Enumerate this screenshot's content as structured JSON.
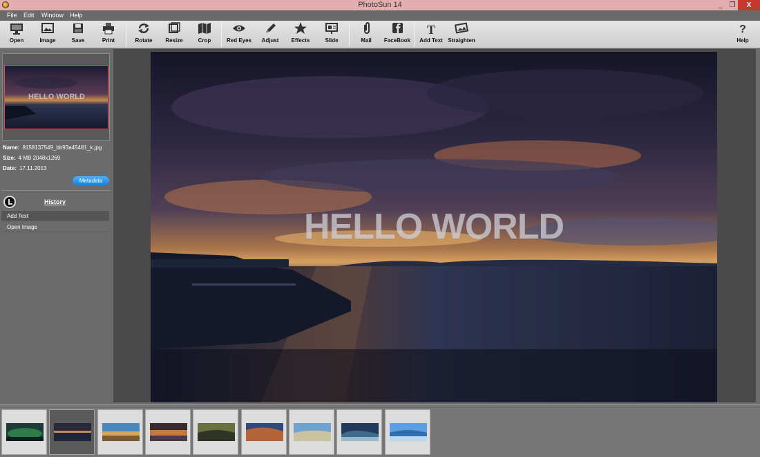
{
  "window": {
    "title": "PhotoSun 14",
    "minimize": "_",
    "maximize": "❐",
    "close": "X"
  },
  "menu": [
    "File",
    "Edit",
    "Window",
    "Help"
  ],
  "toolbar": {
    "open": "Open",
    "image": "Image",
    "save": "Save",
    "print": "Print",
    "rotate": "Rotate",
    "resize": "Resize",
    "crop": "Crop",
    "red_eyes": "Red Eyes",
    "adjust": "Adjust",
    "effects": "Effects",
    "slide": "Slide",
    "mail": "Mail",
    "facebook": "FaceBook",
    "add_text": "Add Text",
    "straighten": "Straighten",
    "help": "Help"
  },
  "file_info": {
    "name_label": "Name:",
    "name_value": "8158137549_bb93a45481_k.jpg",
    "size_label": "Size:",
    "size_value": "4 MB  2048x1269",
    "date_label": "Date:",
    "date_value": "17.11.2013",
    "metadata_button": "Metadata"
  },
  "history": {
    "title": "History",
    "items": [
      "Add Text",
      "Open Image"
    ]
  },
  "photo": {
    "overlay_text": "HELLO WORLD"
  },
  "filmstrip": {
    "count": 9,
    "selected_index": 1
  },
  "colors": {
    "titlebar": "#e2aeb0",
    "close": "#c7372d",
    "accent": "#1a7fd6"
  }
}
